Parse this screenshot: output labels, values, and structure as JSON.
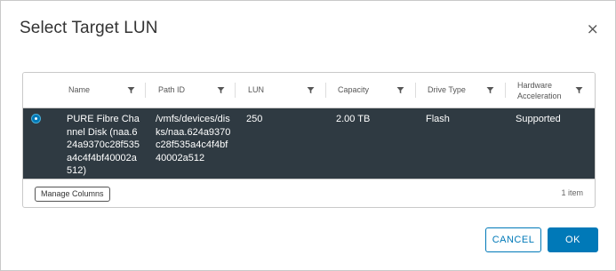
{
  "dialog": {
    "title": "Select Target LUN"
  },
  "table": {
    "columns": [
      {
        "label": "Name"
      },
      {
        "label": "Path ID"
      },
      {
        "label": "LUN"
      },
      {
        "label": "Capacity"
      },
      {
        "label": "Drive Type"
      },
      {
        "label": "Hardware Acceleration"
      }
    ],
    "rows": [
      {
        "selected": true,
        "name": "PURE Fibre Channel Disk (naa.624a9370c28f535a4c4f4bf40002a512)",
        "path_id": "/vmfs/devices/disks/naa.624a9370c28f535a4c4f4bf40002a512",
        "lun": "250",
        "capacity": "2.00 TB",
        "drive_type": "Flash",
        "hardware_acceleration": "Supported"
      }
    ],
    "manage_columns_label": "Manage Columns",
    "item_count": "1 item"
  },
  "buttons": {
    "cancel": "CANCEL",
    "ok": "OK"
  },
  "icons": {
    "close": "close-icon",
    "filter": "filter-icon",
    "radio": "radio-selected-icon"
  },
  "colors": {
    "accent": "#0079b8",
    "selected_row": "#2f3a42"
  }
}
